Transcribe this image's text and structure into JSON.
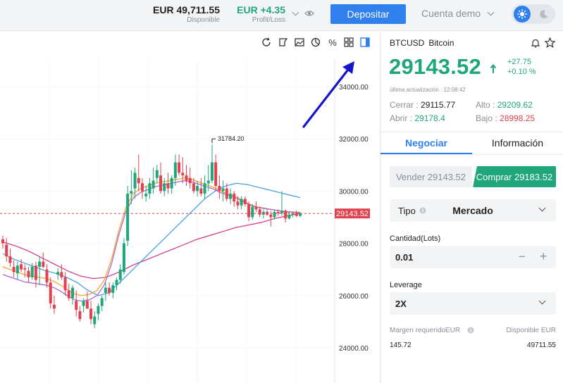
{
  "topbar": {
    "balance_value": "EUR 49,711.55",
    "balance_label": "Disponible",
    "profit_value": "EUR +4.35",
    "profit_label": "Profit/Loss",
    "deposit_label": "Depositar",
    "account_label": "Cuenta demo"
  },
  "chart": {
    "price_axis": [
      "34000.00",
      "32000.00",
      "30000.00",
      "28000.00",
      "26000.00",
      "24000.00"
    ],
    "current_price_tag": "29143.52",
    "high_marker": "31784.20",
    "tools": [
      "refresh-icon",
      "draw-icon",
      "image-icon",
      "pie-icon",
      "percent-icon",
      "grid-icon",
      "panel-icon"
    ],
    "percent_glyph": "%"
  },
  "chart_data": {
    "type": "candlestick",
    "ylim": [
      23500,
      35000
    ],
    "candles": [
      [
        28150,
        28300,
        27800,
        28000
      ],
      [
        27950,
        28200,
        27300,
        27500
      ],
      [
        27500,
        27800,
        27100,
        27250
      ],
      [
        27100,
        27350,
        26700,
        26900
      ],
      [
        26850,
        27300,
        26600,
        27150
      ],
      [
        27200,
        27400,
        26900,
        27000
      ],
      [
        27050,
        27200,
        26700,
        27000
      ],
      [
        26950,
        27100,
        26500,
        26700
      ],
      [
        26700,
        27250,
        26600,
        27100
      ],
      [
        27150,
        27300,
        26300,
        26600
      ],
      [
        27100,
        27500,
        26400,
        27300
      ],
      [
        27300,
        27650,
        27050,
        27100
      ],
      [
        27000,
        27200,
        26300,
        26500
      ],
      [
        26500,
        26700,
        25500,
        25700
      ],
      [
        25650,
        26000,
        25300,
        25500
      ],
      [
        26800,
        27050,
        26600,
        26900
      ],
      [
        26900,
        27200,
        26600,
        26700
      ],
      [
        26700,
        26900,
        26000,
        26200
      ],
      [
        26200,
        26450,
        25800,
        25900
      ],
      [
        25900,
        26400,
        25650,
        26300
      ],
      [
        25800,
        26200,
        25200,
        25450
      ],
      [
        25400,
        25600,
        25000,
        25100
      ],
      [
        25600,
        25900,
        25350,
        25800
      ],
      [
        25800,
        26150,
        25500,
        25500
      ],
      [
        25500,
        25800,
        24900,
        25100
      ],
      [
        24900,
        25400,
        24750,
        25200
      ],
      [
        25300,
        25700,
        25050,
        25600
      ],
      [
        25600,
        26000,
        25400,
        25900
      ],
      [
        26100,
        26500,
        25800,
        26300
      ],
      [
        26300,
        26500,
        26000,
        26100
      ],
      [
        26100,
        26500,
        25900,
        26400
      ],
      [
        26400,
        26700,
        26200,
        26600
      ],
      [
        26600,
        27200,
        26450,
        27000
      ],
      [
        26900,
        28200,
        26800,
        28000
      ],
      [
        28100,
        30200,
        27900,
        29900
      ],
      [
        29900,
        30800,
        29500,
        30000
      ],
      [
        30100,
        30900,
        29700,
        30700
      ],
      [
        30500,
        31400,
        30000,
        30300
      ],
      [
        30300,
        30500,
        29700,
        30000
      ],
      [
        29800,
        30200,
        29600,
        29900
      ],
      [
        29900,
        30500,
        29700,
        30300
      ],
      [
        30100,
        30900,
        29900,
        30400
      ],
      [
        30500,
        31000,
        30300,
        30800
      ],
      [
        30600,
        31100,
        29900,
        30000
      ],
      [
        30000,
        30500,
        29800,
        30300
      ],
      [
        30300,
        30700,
        29900,
        30100
      ],
      [
        30100,
        30600,
        29900,
        30500
      ],
      [
        30500,
        31400,
        30200,
        31100
      ],
      [
        31100,
        31400,
        30600,
        30700
      ],
      [
        30700,
        31300,
        30300,
        30600
      ],
      [
        30600,
        31000,
        30200,
        30400
      ],
      [
        30500,
        30900,
        30100,
        30300
      ],
      [
        30300,
        30500,
        29900,
        30000
      ],
      [
        30000,
        30400,
        29800,
        30200
      ],
      [
        30100,
        30500,
        29800,
        29900
      ],
      [
        29900,
        30600,
        29700,
        30300
      ],
      [
        30300,
        31000,
        30000,
        30400
      ],
      [
        30400,
        31784,
        30300,
        31100
      ],
      [
        31100,
        31400,
        30000,
        30200
      ],
      [
        30200,
        30600,
        29700,
        30000
      ],
      [
        30000,
        30400,
        29600,
        30100
      ],
      [
        30100,
        30300,
        29600,
        29700
      ],
      [
        29700,
        30100,
        29500,
        29900
      ],
      [
        29900,
        30000,
        29400,
        29600
      ],
      [
        29600,
        29800,
        29300,
        29450
      ],
      [
        29450,
        29800,
        29300,
        29700
      ],
      [
        29700,
        29800,
        29400,
        29500
      ],
      [
        29500,
        29600,
        28850,
        29000
      ],
      [
        29000,
        29500,
        28900,
        29400
      ],
      [
        29400,
        29600,
        29200,
        29300
      ],
      [
        29300,
        29400,
        29000,
        29100
      ],
      [
        29100,
        29300,
        28950,
        29200
      ],
      [
        29200,
        29300,
        29050,
        29100
      ],
      [
        29100,
        29250,
        28650,
        29000
      ],
      [
        29000,
        29300,
        28900,
        29200
      ],
      [
        29200,
        29300,
        29050,
        29150
      ],
      [
        29150,
        30000,
        29050,
        29250
      ],
      [
        29250,
        29300,
        28800,
        28950
      ],
      [
        28950,
        29200,
        28900,
        29100
      ],
      [
        29100,
        29200,
        29000,
        29150
      ],
      [
        29150,
        29250,
        29000,
        29050
      ],
      [
        29050,
        29200,
        29000,
        29143
      ]
    ],
    "ma_fast": [
      27100,
      27000,
      26900,
      26800,
      26750,
      26700,
      26650,
      26550,
      26400,
      26200,
      26050,
      26000,
      26050,
      26200,
      26600,
      27400,
      28500,
      29400,
      29900,
      30100,
      30200,
      30300,
      30350,
      30400,
      30450,
      30500,
      30450,
      30350,
      30250,
      30150,
      30000,
      29900,
      29800,
      29650,
      29500,
      29400,
      29350,
      29300,
      29250,
      29200,
      29180,
      29150
    ],
    "ma_slow": [
      27600,
      27400,
      27250,
      27100,
      26950,
      26850,
      26700,
      26500,
      26200,
      26000,
      26100,
      26500,
      26900,
      27300,
      27700,
      28100,
      28500,
      28900,
      29300,
      29700,
      30000,
      30200,
      30300,
      30250,
      30150,
      30050,
      29950,
      29850,
      29750
    ],
    "ma_long": [
      28050,
      27900,
      27700,
      27450,
      27200,
      26950,
      26750,
      26650,
      26700,
      26900,
      27150,
      27350,
      27550,
      27750,
      27950,
      28150,
      28300,
      28450,
      28600,
      28700,
      28800,
      28950,
      29050,
      29150
    ]
  },
  "panel": {
    "symbol": "BTCUSD",
    "symbol_name": "Bitcoin",
    "price": "29143.52",
    "change_abs": "+27.75",
    "change_pct": "+0.10 %",
    "last_update": "última actualización : 12:08:42",
    "close_label": "Cerrar :",
    "close_value": "29115.77",
    "high_label": "Alto :",
    "high_value": "29209.62",
    "open_label": "Abrir :",
    "open_value": "29178.4",
    "low_label": "Bajo :",
    "low_value": "28998.25",
    "tab_trade": "Negociar",
    "tab_info": "Información",
    "sell_label": "Vender 29143.52",
    "buy_label": "Comprar 29183.52",
    "type_label": "Tipo",
    "type_value": "Mercado",
    "qty_label": "Cantidad(Lots)",
    "qty_value": "0.01",
    "leverage_label": "Leverage",
    "leverage_value": "2X",
    "margin_label": "Margen requeridoEUR",
    "margin_value": "145.72",
    "available_label": "Disponible EUR",
    "available_value": "49711.55"
  },
  "colors": {
    "accent": "#2f80ed",
    "up": "#1fa67a",
    "down": "#e0434f",
    "arrow": "#1414c8"
  }
}
